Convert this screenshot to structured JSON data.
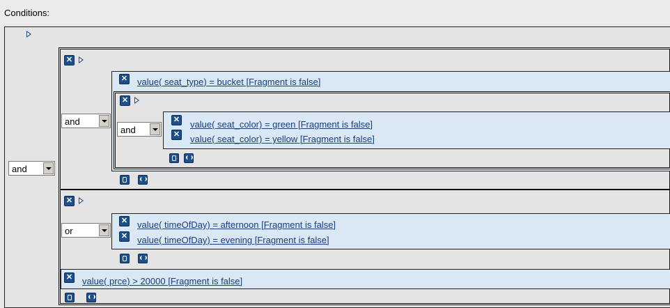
{
  "header": {
    "label": "Conditions:"
  },
  "root": {
    "operator": "and"
  },
  "group1": {
    "operator": "and",
    "cond1": "value(  seat_type) = bucket [Fragment is false]",
    "subgroup": {
      "operator": "and",
      "cond1": "value(  seat_color) = green [Fragment is false]",
      "cond2": "value(  seat_color) = yellow  [Fragment is false]"
    }
  },
  "group2": {
    "operator": "or",
    "cond1": "value(  timeOfDay) = afternoon [Fragment is false]",
    "cond2": "value(  timeOfDay) = evening [Fragment is false]"
  },
  "cond_price": "value(  prce) > 20000 [Fragment is false]",
  "icons": {
    "remove": "close-x-icon",
    "expand": "triangle-right-icon",
    "add_condition": "add-condition-icon",
    "add_group": "add-group-icon"
  }
}
